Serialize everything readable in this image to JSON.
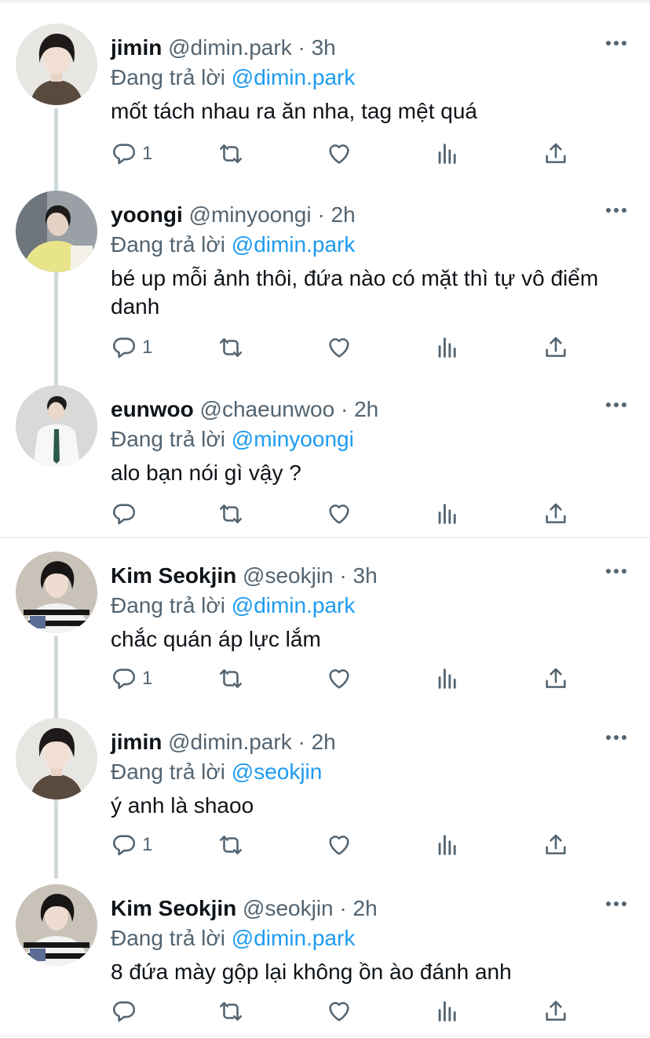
{
  "colors": {
    "text": "#0f1419",
    "secondary": "#536471",
    "link": "#1d9bf0",
    "divider": "#eff3f4",
    "thread": "#cfd9de"
  },
  "icons": {
    "reply": "reply-icon",
    "retweet": "retweet-icon",
    "like": "heart-icon",
    "views": "views-icon",
    "share": "share-icon",
    "more": "more-icon"
  },
  "tweets": [
    {
      "name": "jimin",
      "handle": "@dimin.park",
      "sep": "·",
      "time": "3h",
      "reply_prefix": "Đang trả lời",
      "reply_to": "@dimin.park",
      "text": "mốt tách nhau ra ăn nha, tag mệt quá",
      "reply_count": "1"
    },
    {
      "name": "yoongi",
      "handle": "@minyoongi",
      "sep": "·",
      "time": "2h",
      "reply_prefix": "Đang trả lời",
      "reply_to": "@dimin.park",
      "text": "bé up mỗi ảnh thôi, đứa nào có mặt thì tự vô điểm danh",
      "reply_count": "1"
    },
    {
      "name": "eunwoo",
      "handle": "@chaeunwoo",
      "sep": "·",
      "time": "2h",
      "reply_prefix": "Đang trả lời",
      "reply_to": "@minyoongi",
      "text": "alo bạn nói gì vậy ?",
      "reply_count": ""
    },
    {
      "name": "Kim Seokjin",
      "handle": "@seokjin",
      "sep": "·",
      "time": "3h",
      "reply_prefix": "Đang trả lời",
      "reply_to": "@dimin.park",
      "text": "chắc quán áp lực lắm",
      "reply_count": "1"
    },
    {
      "name": "jimin",
      "handle": "@dimin.park",
      "sep": "·",
      "time": "2h",
      "reply_prefix": "Đang trả lời",
      "reply_to": "@seokjin",
      "text": "ý anh là shaoo",
      "reply_count": "1"
    },
    {
      "name": "Kim Seokjin",
      "handle": "@seokjin",
      "sep": "·",
      "time": "2h",
      "reply_prefix": "Đang trả lời",
      "reply_to": "@dimin.park",
      "text": "8 đứa mày gộp lại không ồn ào đánh anh",
      "reply_count": ""
    }
  ]
}
